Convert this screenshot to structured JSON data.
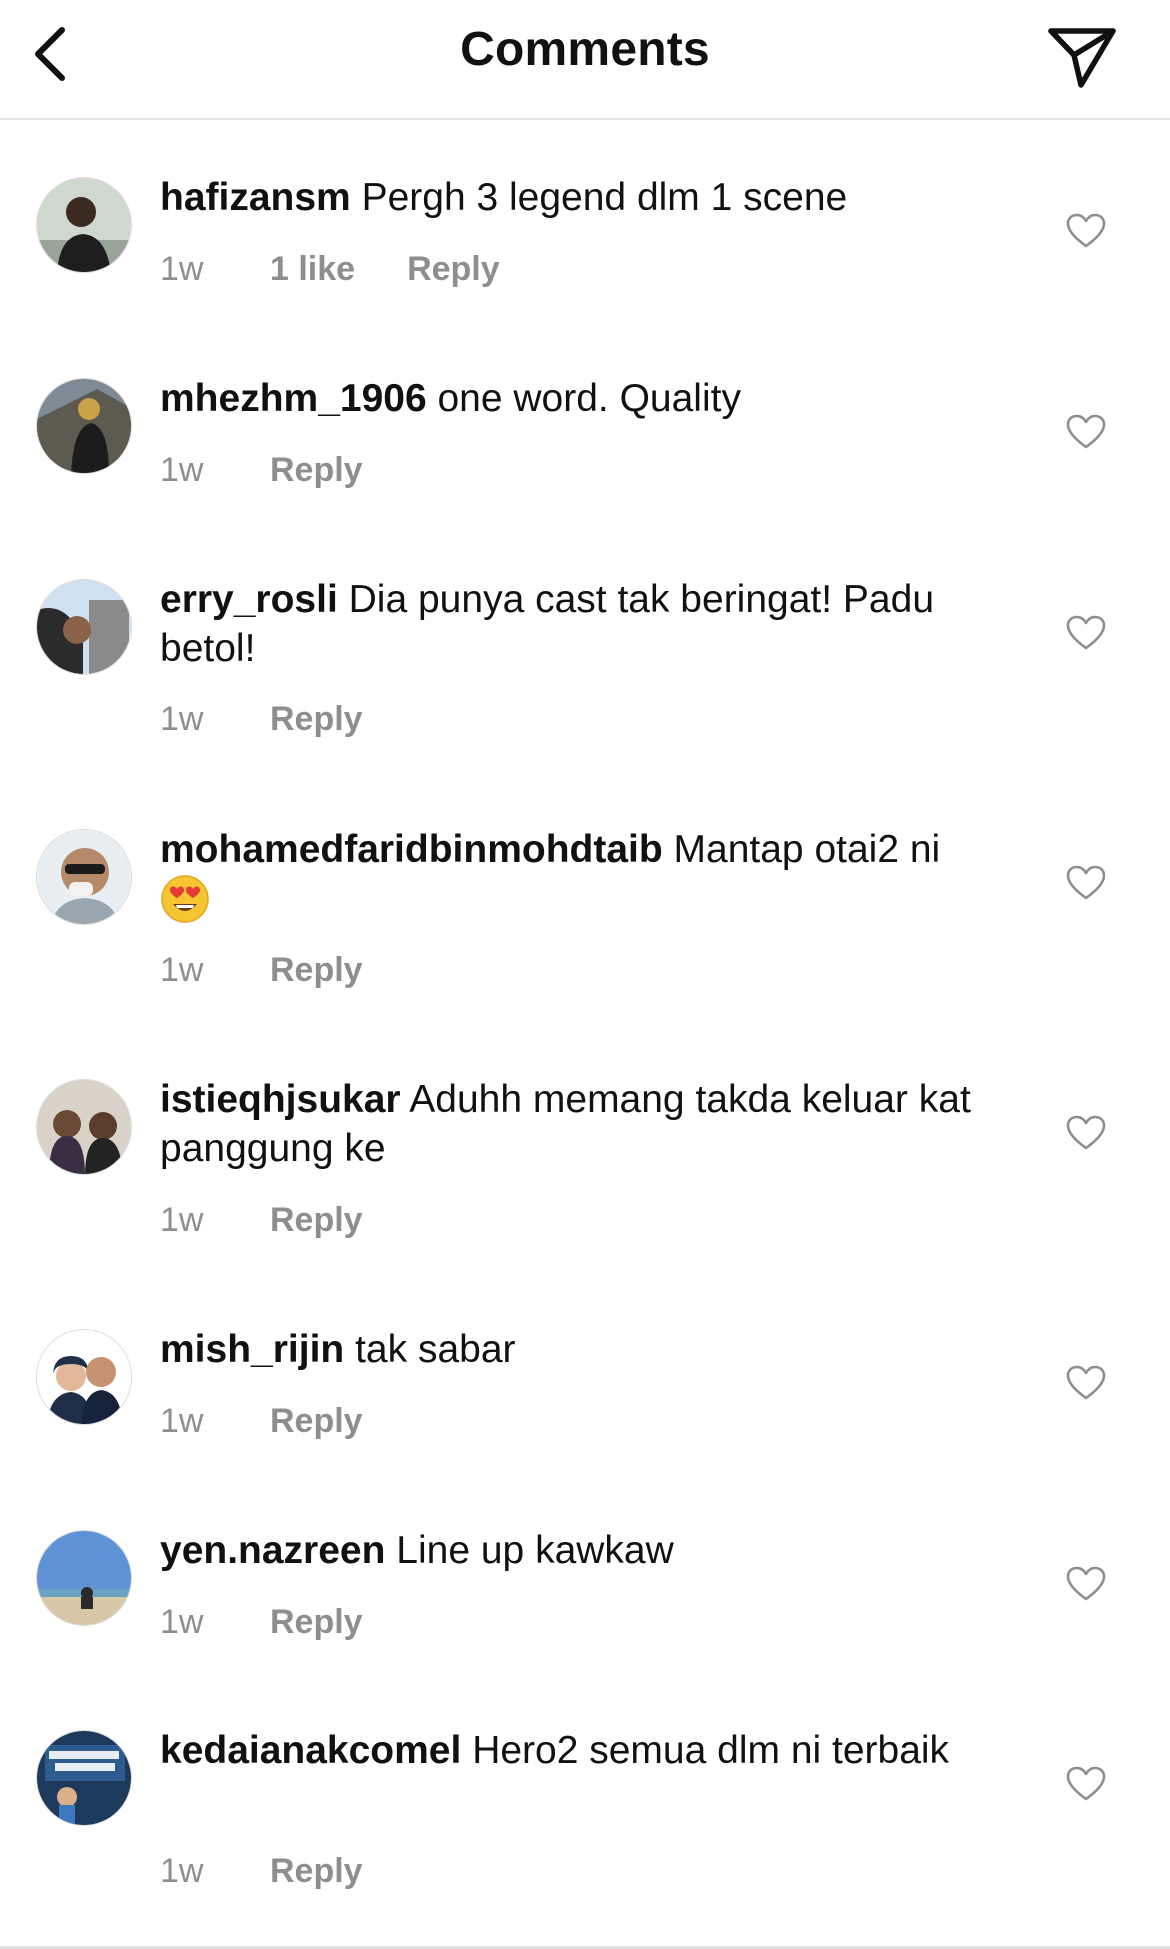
{
  "header": {
    "title": "Comments",
    "back_icon": "chevron-left-icon",
    "share_icon": "paper-plane-icon"
  },
  "colors": {
    "text": "#111111",
    "meta": "#8e8e8e",
    "divider": "#e6e6e6"
  },
  "comments": [
    {
      "username": "hafizansm",
      "text": "Pergh 3 legend dlm 1 scene",
      "time": "1w",
      "likes": "1 like",
      "reply": "Reply"
    },
    {
      "username": "mhezhm_1906",
      "text": "one word. Quality",
      "time": "1w",
      "reply": "Reply"
    },
    {
      "username": "erry_rosli",
      "text": "Dia punya cast tak beringat! Padu betol!",
      "time": "1w",
      "reply": "Reply"
    },
    {
      "username": "mohamedfaridbinmohdtaib",
      "text": "Mantap otai2 ni",
      "emoji": "heart-eyes-emoji",
      "time": "1w",
      "reply": "Reply"
    },
    {
      "username": "istieqhjsukar",
      "text": "Aduhh memang takda keluar kat panggung ke",
      "time": "1w",
      "reply": "Reply"
    },
    {
      "username": "mish_rijin",
      "text": "tak sabar",
      "time": "1w",
      "reply": "Reply"
    },
    {
      "username": "yen.nazreen",
      "text": "Line up kawkaw",
      "time": "1w",
      "reply": "Reply"
    },
    {
      "username": "kedaianakcomel",
      "text": "Hero2 semua dlm ni terbaik",
      "time": "1w",
      "reply": "Reply"
    }
  ]
}
